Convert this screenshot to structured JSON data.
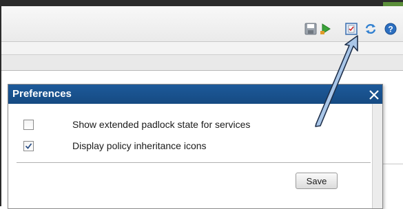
{
  "toolbar": {
    "icons": [
      "save-icon",
      "run-icon",
      "preferences-icon",
      "refresh-icon",
      "help-icon"
    ]
  },
  "dialog": {
    "title": "Preferences",
    "options": [
      {
        "label": "Show extended padlock state for services",
        "checked": false
      },
      {
        "label": "Display policy inheritance icons",
        "checked": true
      }
    ],
    "save_label": "Save"
  },
  "colors": {
    "header": "#1d5a9a",
    "callout_arrow": "#a9c6e8",
    "arrow_outline": "#1e2f4a"
  }
}
